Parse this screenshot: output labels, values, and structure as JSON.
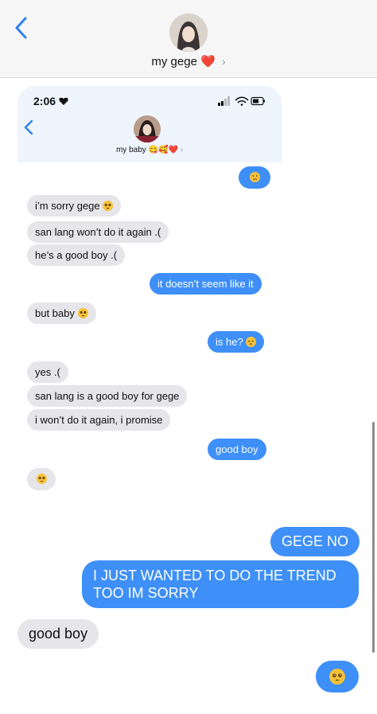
{
  "header": {
    "contact_name": "my gege",
    "heart": "❤️",
    "chevron": "›"
  },
  "inner": {
    "time": "2:06",
    "contact_name": "my baby",
    "emojis": "😋🥰❤️",
    "chevron": "›"
  },
  "messages": [
    {
      "side": "sent",
      "text": "",
      "emoji": "neutral-face"
    },
    {
      "side": "recv",
      "text": "i’m sorry gege",
      "emoji": "pleading-face"
    },
    {
      "side": "recv",
      "text": "san lang won’t do it again .("
    },
    {
      "side": "recv",
      "text": "he’s a good boy .("
    },
    {
      "side": "sent",
      "text": "it doesn’t seem like it"
    },
    {
      "side": "recv",
      "text": "but baby",
      "emoji": "pleading-face"
    },
    {
      "side": "sent",
      "text": "is he?",
      "emoji": "pensive-face"
    },
    {
      "side": "recv",
      "text": "yes .("
    },
    {
      "side": "recv",
      "text": "san lang is a good boy for gege"
    },
    {
      "side": "recv",
      "text": "i won’t do it again, i promise"
    },
    {
      "side": "sent",
      "text": "good boy"
    },
    {
      "side": "recv",
      "text": "",
      "emoji": "pleading-face"
    },
    {
      "side": "sent",
      "text": "GEGE NO"
    },
    {
      "side": "sent",
      "text": "I JUST WANTED TO DO THE TREND TOO IM SORRY"
    },
    {
      "side": "recv",
      "text": "good boy"
    },
    {
      "side": "sent",
      "text": "",
      "emoji": "pleading-face"
    }
  ],
  "colors": {
    "sent": "#3e8ff7",
    "received": "#e5e5ea",
    "header_bg": "#f6f6f6",
    "back_arrow": "#2f80ed"
  }
}
